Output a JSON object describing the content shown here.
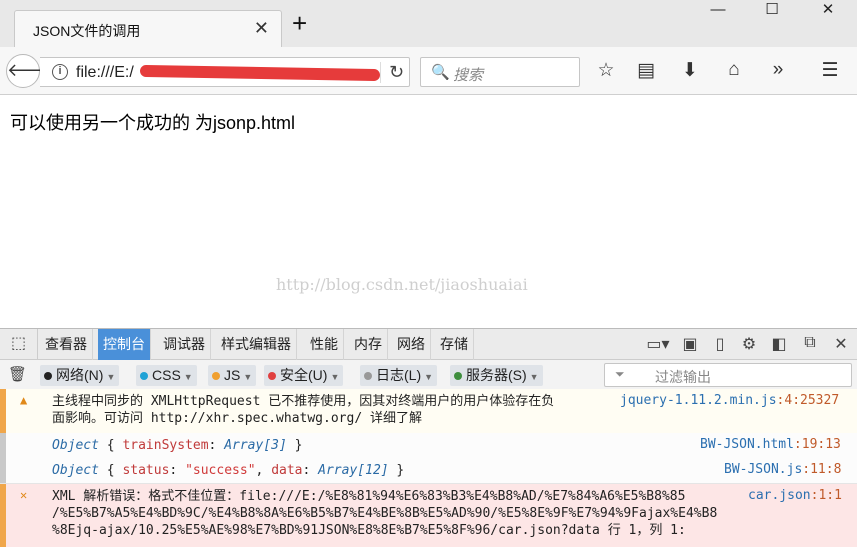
{
  "browser": {
    "tab_title": "JSON文件的调用",
    "tab_close": "✕",
    "new_tab": "+",
    "window": {
      "minimize": "—",
      "maximize": "☐",
      "close": "✕"
    },
    "url_text": "file:///E:/",
    "search_placeholder": "搜索"
  },
  "page": {
    "text": "可以使用另一个成功的 为jsonp.html",
    "watermark": "http://blog.csdn.net/jiaoshuaiai"
  },
  "devtools": {
    "tabs": [
      "查看器",
      "控制台",
      "调试器",
      "样式编辑器",
      "性能",
      "内存",
      "网络",
      "存储"
    ],
    "active_tab": "控制台",
    "filters": [
      {
        "label": "网络(N)",
        "color": "#222222"
      },
      {
        "label": "CSS",
        "color": "#1fa2d6"
      },
      {
        "label": "JS",
        "color": "#f0a030"
      },
      {
        "label": "安全(U)",
        "color": "#e04040"
      },
      {
        "label": "日志(L)",
        "color": "#999999"
      },
      {
        "label": "服务器(S)",
        "color": "#3e8e3e"
      }
    ],
    "filter_placeholder": "过滤输出",
    "logs": {
      "warning": {
        "line1": "主线程中同步的 XMLHttpRequest 已不推荐使用，因其对终端用户的用户体验存在负",
        "line2": "面影响。可访问 http://xhr.spec.whatwg.org/ 详细了解",
        "source": "jquery-1.11.2.min.js",
        "source_loc": ":4:25327"
      },
      "obj1": {
        "type": "Object",
        "key": "trainSystem",
        "value": "Array[3]",
        "source": "BW-JSON.html",
        "source_loc": ":19:13"
      },
      "obj2": {
        "type": "Object",
        "key1": "status",
        "val1": "\"success\"",
        "key2": "data",
        "val2": "Array[12]",
        "source": "BW-JSON.js",
        "source_loc": ":11:8"
      },
      "error": {
        "line1": "XML 解析错误：格式不佳位置：file:///E:/%E8%81%94%E6%83%B3%E4%B8%AD/%E7%84%A6%E5%B8%85",
        "line2": "/%E5%B7%A5%E4%BD%9C/%E4%B8%8A%E6%B5%B7%E4%BE%8B%E5%AD%90/%E5%8E%9F%E7%94%9Fajax%E4%B8",
        "line3": "%8Ejq-ajax/10.25%E5%AE%98%E7%BD%91JSON%E8%8E%B7%E5%8F%96/car.json?data 行 1，列 1:",
        "source": "car.json",
        "source_loc": ":1:1"
      }
    }
  }
}
